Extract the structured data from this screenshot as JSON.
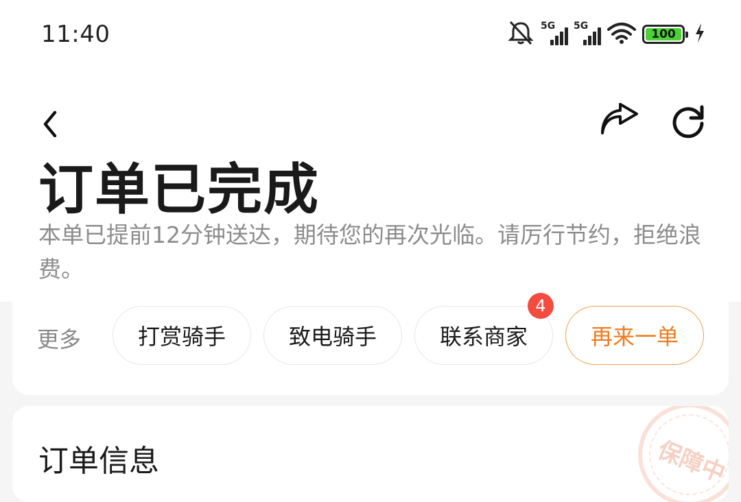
{
  "status_bar": {
    "time": "11:40",
    "network_1": "5G",
    "network_2": "5G",
    "battery": "100",
    "icons": [
      "mute-bell-icon",
      "signal-icon",
      "signal-icon",
      "wifi-icon",
      "battery-icon",
      "charging-bolt-icon"
    ],
    "battery_color": "#4cd137"
  },
  "nav": {
    "icons": [
      "back-chevron-icon",
      "share-icon",
      "refresh-icon"
    ]
  },
  "order": {
    "title": "订单已完成",
    "subtitle": "本单已提前12分钟送达，期待您的再次光临。请厉行节约，拒绝浪费。"
  },
  "actions": {
    "more_label": "更多",
    "buttons": [
      {
        "label": "打赏骑手"
      },
      {
        "label": "致电骑手"
      },
      {
        "label": "联系商家",
        "badge": "4"
      },
      {
        "label": "再来一单"
      }
    ],
    "accent_color": "#ef7b1f",
    "badge_color": "#f34b3f"
  },
  "info": {
    "title": "订单信息",
    "stamp_text": "保障中"
  }
}
